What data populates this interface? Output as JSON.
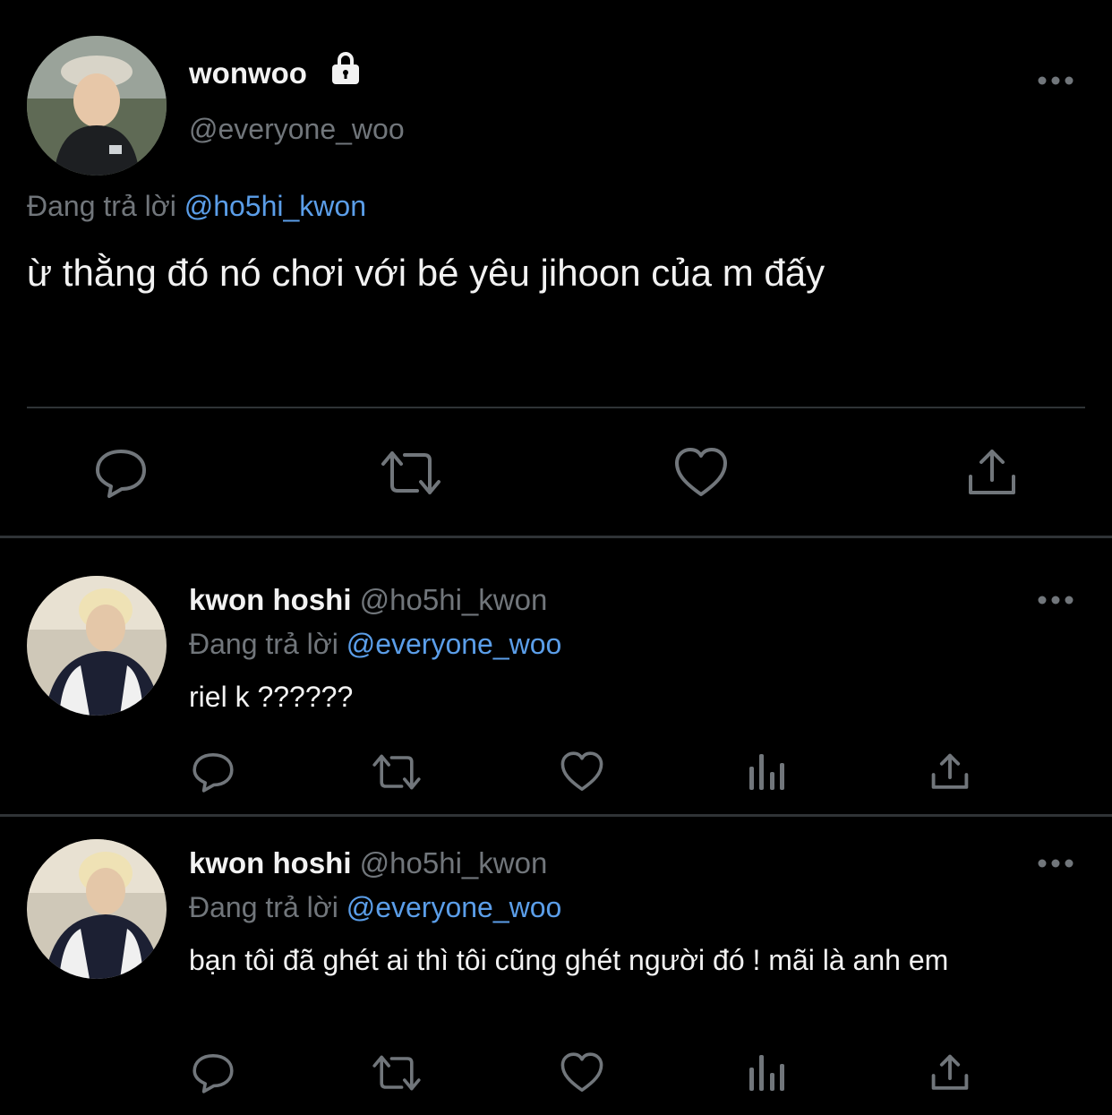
{
  "main_tweet": {
    "display_name": "wonwoo",
    "handle": "@everyone_woo",
    "locked_icon": "lock-icon",
    "replying_label": "Đang trả lời",
    "replying_to": "@ho5hi_kwon",
    "text": "ừ thằng đó nó chơi với bé yêu jihoon của m đấy",
    "actions": [
      "reply-icon",
      "retweet-icon",
      "like-icon",
      "share-icon"
    ]
  },
  "replies": [
    {
      "display_name": "kwon hoshi",
      "handle": "@ho5hi_kwon",
      "replying_label": "Đang trả lời",
      "replying_to": "@everyone_woo",
      "text": "riel k ??????",
      "actions": [
        "reply-icon",
        "retweet-icon",
        "like-icon",
        "analytics-icon",
        "share-icon"
      ]
    },
    {
      "display_name": "kwon hoshi",
      "handle": "@ho5hi_kwon",
      "replying_label": "Đang trả lời",
      "replying_to": "@everyone_woo",
      "text": "bạn tôi đã ghét ai thì tôi cũng ghét người đó ! mãi là anh em",
      "actions": [
        "reply-icon",
        "retweet-icon",
        "like-icon",
        "analytics-icon",
        "share-icon"
      ]
    }
  ],
  "colors": {
    "background": "#000000",
    "text": "#e7e9ea",
    "muted": "#71767b",
    "link": "#5b9ee9",
    "divider": "#2f3336"
  }
}
